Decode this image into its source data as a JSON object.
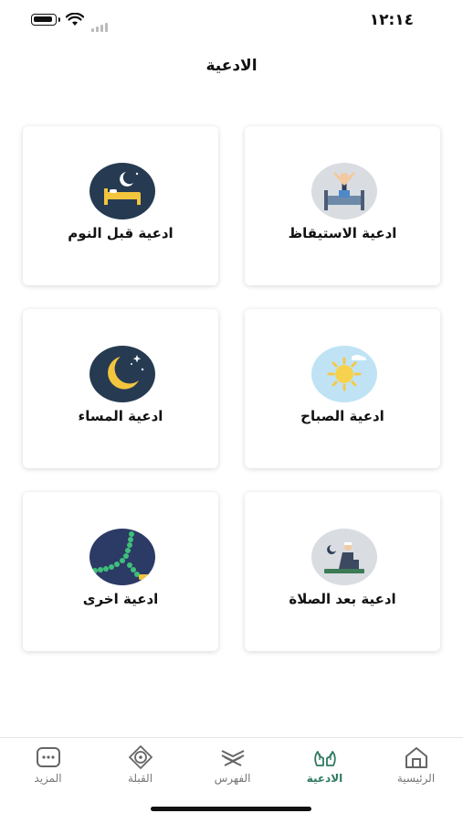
{
  "status_bar": {
    "time": "١٢:١٤"
  },
  "header": {
    "title": "الادعية"
  },
  "cards": [
    {
      "label": "ادعية الاستيقاظ",
      "icon": "wake-up-icon"
    },
    {
      "label": "ادعية قبل النوم",
      "icon": "sleep-icon"
    },
    {
      "label": "ادعية الصباح",
      "icon": "sun-icon"
    },
    {
      "label": "ادعية المساء",
      "icon": "moon-icon"
    },
    {
      "label": "ادعية بعد الصلاة",
      "icon": "prayer-icon"
    },
    {
      "label": "ادعية اخرى",
      "icon": "prayer-beads-icon"
    }
  ],
  "tabs": [
    {
      "label": "الرئيسية",
      "icon": "home-icon",
      "active": false
    },
    {
      "label": "الادعية",
      "icon": "praying-hands-icon",
      "active": true
    },
    {
      "label": "الفهرس",
      "icon": "quran-stand-icon",
      "active": false
    },
    {
      "label": "القبلة",
      "icon": "compass-icon",
      "active": false
    },
    {
      "label": "المزيد",
      "icon": "more-icon",
      "active": false
    }
  ],
  "colors": {
    "accent": "#2f7a5e",
    "card_dark": "#263a52",
    "card_light": "#d9dde2",
    "sky": "#bfe3f5"
  }
}
